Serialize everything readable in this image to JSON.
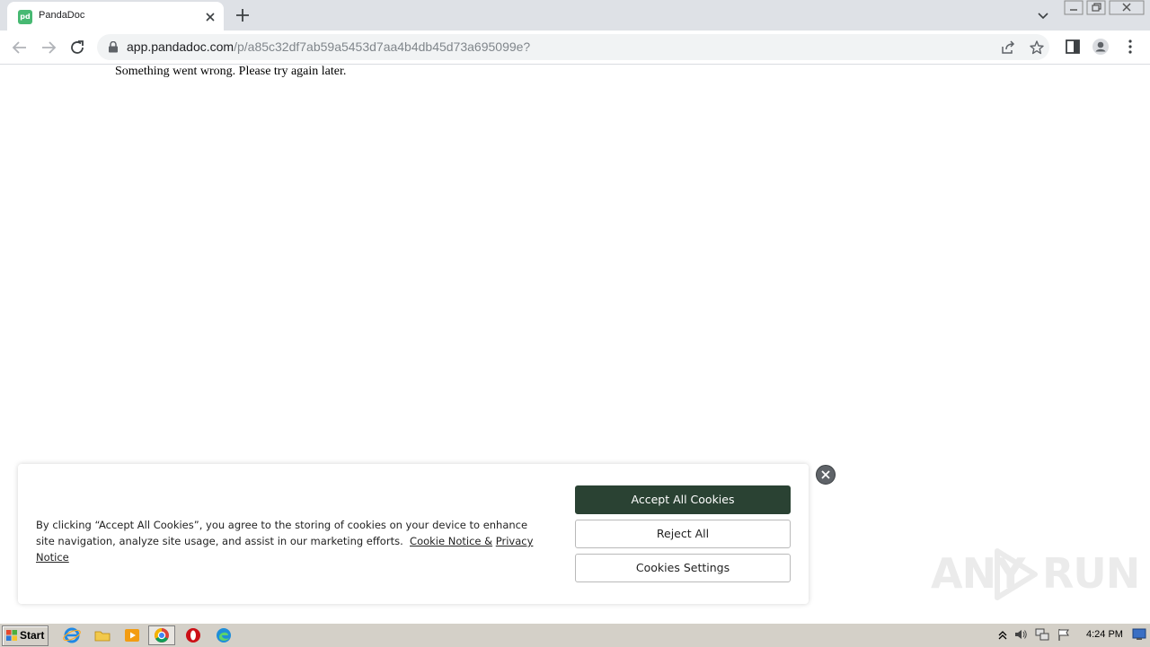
{
  "browser": {
    "tab": {
      "title": "PandaDoc",
      "favicon_text": "pd"
    },
    "url": {
      "host": "app.pandadoc.com",
      "path": "/p/a85c32df7ab59a5453d7aa4b4db45d73a695099e?"
    }
  },
  "page": {
    "error_message": "Something went wrong. Please try again later."
  },
  "cookie_banner": {
    "text": "By clicking “Accept All Cookies”, you agree to the storing of cookies on your device to enhance site navigation, analyze site usage, and assist in our marketing efforts.",
    "cookie_notice_link": "Cookie Notice &",
    "privacy_notice_link": "Privacy Notice",
    "accept_label": "Accept All Cookies",
    "reject_label": "Reject All",
    "settings_label": "Cookies Settings"
  },
  "watermark": {
    "text_left": "ANY",
    "text_right": "RUN"
  },
  "taskbar": {
    "start_label": "Start",
    "clock": "4:24 PM"
  },
  "colors": {
    "accept_button": "#2a4233",
    "tabstrip": "#dee1e6",
    "taskbar": "#d4d0c8"
  }
}
